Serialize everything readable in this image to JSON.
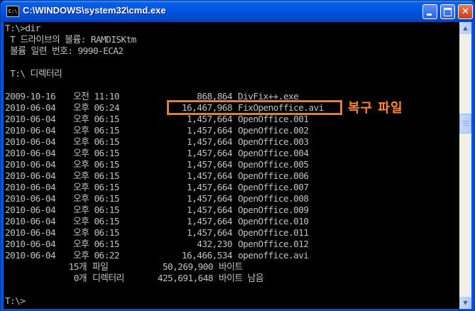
{
  "window": {
    "title": "C:\\WINDOWS\\system32\\cmd.exe",
    "icon_text": "C:\\",
    "buttons": [
      "minimize-icon",
      "maximize-icon",
      "close-icon"
    ],
    "close_glyph": "✕"
  },
  "console": {
    "prompt_command": "T:\\>dir",
    "volume_line": " T 드라이브의 볼륨: RAMDISKtm",
    "serial_line": " 볼륨 일련 번호: 9990-ECA2",
    "dir_header": " T:\\ 디렉터리",
    "files": [
      {
        "date": "2009-10-16",
        "time": "오전 11:10",
        "size": "868,864",
        "name": "DivFix++.exe"
      },
      {
        "date": "2010-06-04",
        "time": "오후 06:24",
        "size": "16,467,968",
        "name": "FixOpenoffice.avi"
      },
      {
        "date": "2010-06-04",
        "time": "오후 06:15",
        "size": "1,457,664",
        "name": "OpenOffice.001"
      },
      {
        "date": "2010-06-04",
        "time": "오후 06:15",
        "size": "1,457,664",
        "name": "OpenOffice.002"
      },
      {
        "date": "2010-06-04",
        "time": "오후 06:15",
        "size": "1,457,664",
        "name": "OpenOffice.003"
      },
      {
        "date": "2010-06-04",
        "time": "오후 06:15",
        "size": "1,457,664",
        "name": "OpenOffice.004"
      },
      {
        "date": "2010-06-04",
        "time": "오후 06:15",
        "size": "1,457,664",
        "name": "OpenOffice.005"
      },
      {
        "date": "2010-06-04",
        "time": "오후 06:15",
        "size": "1,457,664",
        "name": "OpenOffice.006"
      },
      {
        "date": "2010-06-04",
        "time": "오후 06:15",
        "size": "1,457,664",
        "name": "OpenOffice.007"
      },
      {
        "date": "2010-06-04",
        "time": "오후 06:15",
        "size": "1,457,664",
        "name": "OpenOffice.008"
      },
      {
        "date": "2010-06-04",
        "time": "오후 06:15",
        "size": "1,457,664",
        "name": "OpenOffice.009"
      },
      {
        "date": "2010-06-04",
        "time": "오후 06:15",
        "size": "1,457,664",
        "name": "OpenOffice.010"
      },
      {
        "date": "2010-06-04",
        "time": "오후 06:15",
        "size": "1,457,664",
        "name": "OpenOffice.011"
      },
      {
        "date": "2010-06-04",
        "time": "오후 06:15",
        "size": "432,230",
        "name": "OpenOffice.012"
      },
      {
        "date": "2010-06-04",
        "time": "오후 06:22",
        "size": "16,466,534",
        "name": "openoffice.avi"
      }
    ],
    "summary_files": {
      "count": "15개",
      "label": "파일",
      "size": "50,269,900",
      "unit": "바이트"
    },
    "summary_dirs": {
      "count": "0개",
      "label": "디렉터리",
      "size": "425,691,648",
      "unit": "바이트 남음"
    },
    "final_prompt": "T:\\>"
  },
  "annotation": {
    "text": "복구 파일",
    "color": "#f07b22"
  },
  "scrollbar": {
    "up_icon": "scroll-up-arrow-icon",
    "down_icon": "scroll-down-arrow-icon",
    "up_glyph": "▲",
    "down_glyph": "▼"
  }
}
